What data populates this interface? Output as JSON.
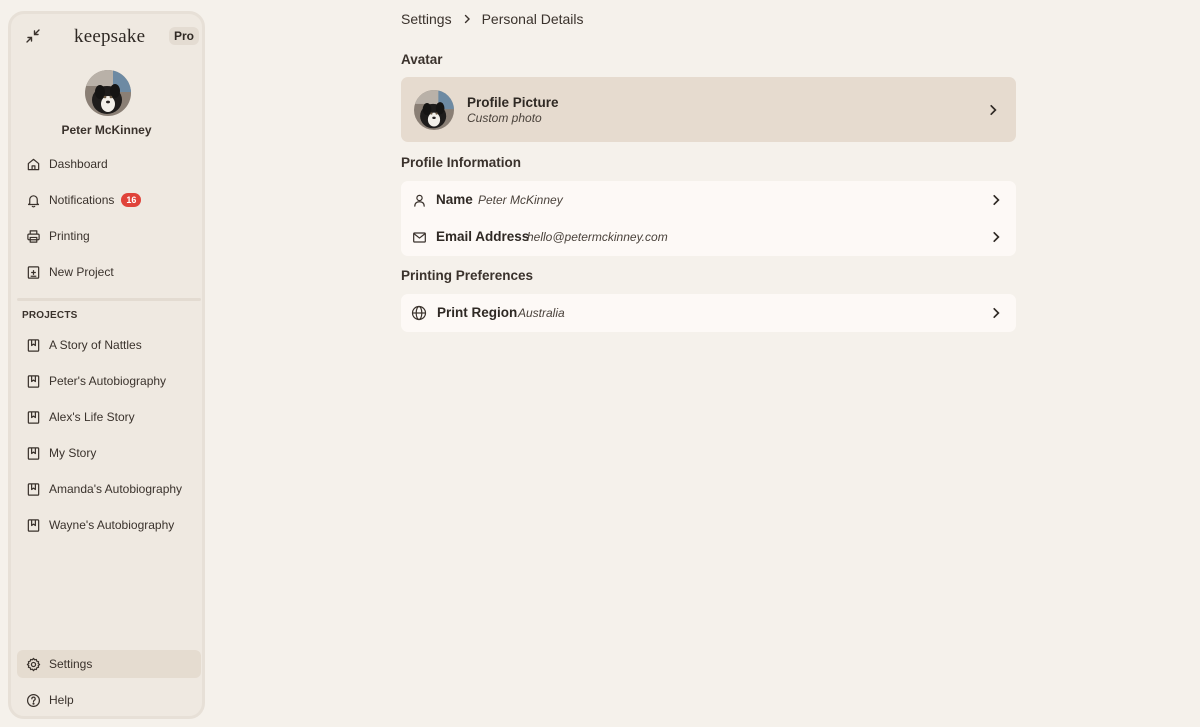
{
  "app": {
    "logo": "keepsake",
    "plan_badge": "Pro"
  },
  "user": {
    "name": "Peter McKinney"
  },
  "nav": {
    "dashboard": "Dashboard",
    "notifications": "Notifications",
    "notifications_count": "16",
    "printing": "Printing",
    "new_project": "New Project"
  },
  "projects": {
    "label": "PROJECTS",
    "items": [
      "A Story of Nattles",
      "Peter's Autobiography",
      "Alex's Life Story",
      "My Story",
      "Amanda's Autobiography",
      "Wayne's Autobiography"
    ]
  },
  "footer_nav": {
    "settings": "Settings",
    "help": "Help"
  },
  "breadcrumb": {
    "parent": "Settings",
    "current": "Personal Details"
  },
  "avatar_section": {
    "title": "Avatar",
    "item_title": "Profile Picture",
    "item_subtitle": "Custom photo"
  },
  "profile_section": {
    "title": "Profile Information",
    "name_label": "Name",
    "name_value": "Peter McKinney",
    "email_label": "Email Address",
    "email_value": "hello@petermckinney.com"
  },
  "printing_section": {
    "title": "Printing Preferences",
    "region_label": "Print Region",
    "region_value": "Australia"
  },
  "colors": {
    "background": "#f5f1eb",
    "sidebar": "#efe9e1",
    "active_item": "#e5dcd0",
    "avatar_card": "#e6dbcf",
    "card": "#fdf9f6",
    "badge": "#e0433a"
  },
  "icons": {
    "collapse": "collapse-arrows-icon",
    "dashboard": "home-icon",
    "notifications": "bell-icon",
    "printing": "printer-icon",
    "new_project": "add-document-icon",
    "project": "book-bookmark-icon",
    "settings": "gear-icon",
    "help": "question-circle-icon",
    "name": "person-icon",
    "email": "mail-icon",
    "region": "globe-icon",
    "chevron": "chevron-right-icon"
  }
}
